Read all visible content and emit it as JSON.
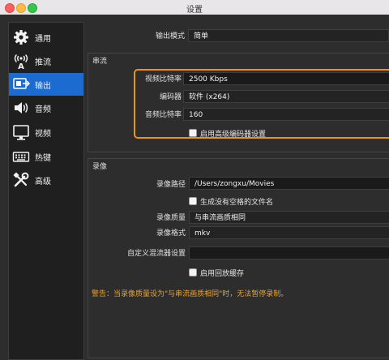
{
  "window": {
    "title": "设置"
  },
  "sidebar": {
    "items": [
      {
        "label": "通用",
        "icon": "gear-icon"
      },
      {
        "label": "推流",
        "icon": "broadcast-antenna-icon"
      },
      {
        "label": "输出",
        "icon": "output-icon",
        "active": true
      },
      {
        "label": "音频",
        "icon": "speaker-icon"
      },
      {
        "label": "视频",
        "icon": "monitor-icon"
      },
      {
        "label": "热键",
        "icon": "keyboard-icon"
      },
      {
        "label": "高级",
        "icon": "tools-icon"
      }
    ]
  },
  "output": {
    "mode_label": "输出模式",
    "mode_value": "简单"
  },
  "streaming": {
    "title": "串流",
    "video_bitrate_label": "视频比特率",
    "video_bitrate_value": "2500 Kbps",
    "encoder_label": "编码器",
    "encoder_value": "软件 (x264)",
    "audio_bitrate_label": "音频比特率",
    "audio_bitrate_value": "160",
    "advanced_encoder_checkbox": "启用高级编码器设置"
  },
  "recording": {
    "title": "录像",
    "path_label": "录像路径",
    "path_value": "/Users/zongxu/Movies",
    "no_space_checkbox": "生成没有空格的文件名",
    "quality_label": "录像质量",
    "quality_value": "与串流画质相同",
    "format_label": "录像格式",
    "format_value": "mkv",
    "muxer_label": "自定义混流器设置",
    "muxer_value": "",
    "replay_buffer_checkbox": "启用回放缓存"
  },
  "warning": "警告：当录像质量设为\"与串流画质相同\"时，无法暂停录制。",
  "colors": {
    "accent": "#1c6bd0",
    "highlight": "#e8951f",
    "warning": "#e7a135"
  }
}
